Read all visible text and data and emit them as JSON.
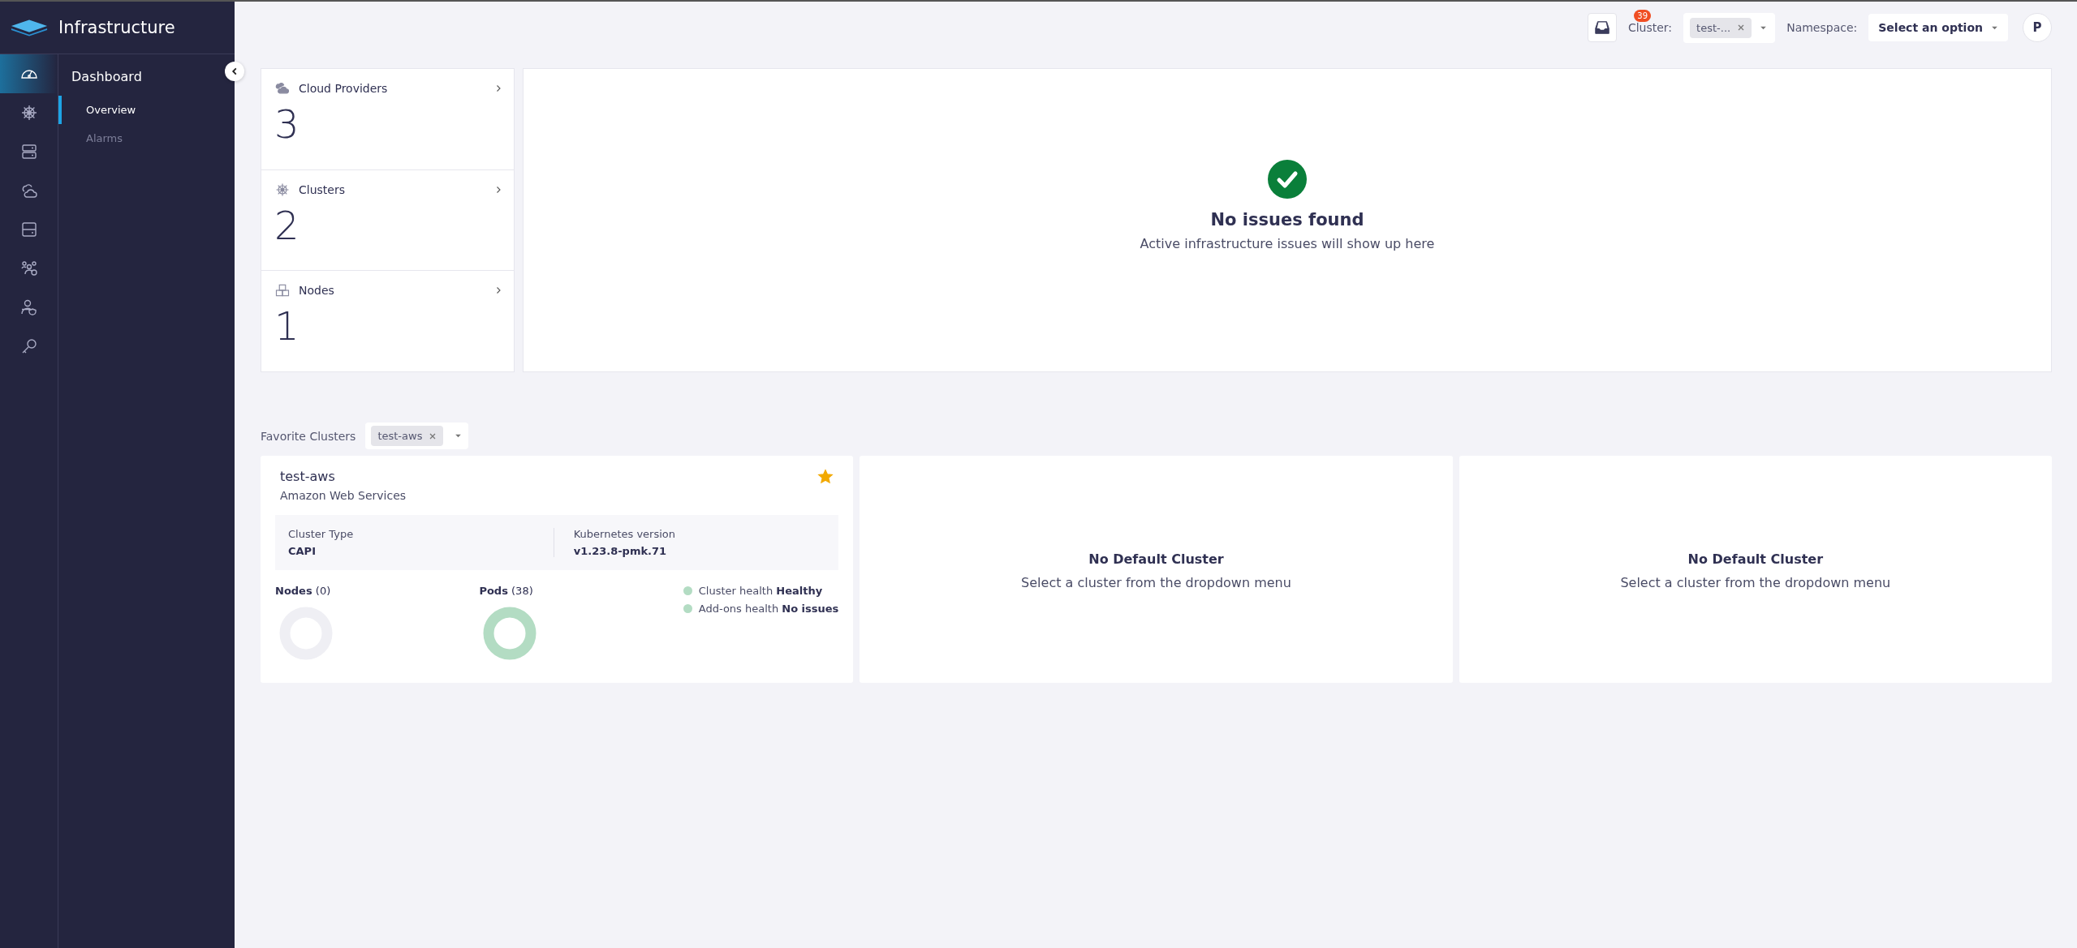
{
  "app": {
    "title": "Infrastructure"
  },
  "rail": [
    {
      "kind": "dashboard",
      "selected": true
    },
    {
      "kind": "helm",
      "selected": false
    },
    {
      "kind": "servers",
      "selected": false
    },
    {
      "kind": "clouds",
      "selected": false
    },
    {
      "kind": "storage",
      "selected": false
    },
    {
      "kind": "tenants",
      "selected": false
    },
    {
      "kind": "user-shield",
      "selected": false
    },
    {
      "kind": "key",
      "selected": false
    }
  ],
  "subnav": {
    "title": "Dashboard",
    "items": [
      {
        "label": "Overview",
        "selected": true
      },
      {
        "label": "Alarms",
        "selected": false
      }
    ]
  },
  "topbar": {
    "notifications": "39",
    "cluster_label": "Cluster:",
    "cluster_chip": "test-...",
    "namespace_label": "Namespace:",
    "namespace_value": "Select an option",
    "avatar": "P"
  },
  "summary": [
    {
      "kind": "clouds",
      "title": "Cloud Providers",
      "count": "3"
    },
    {
      "kind": "helm",
      "title": "Clusters",
      "count": "2"
    },
    {
      "kind": "nodes",
      "title": "Nodes",
      "count": "1"
    }
  ],
  "issues": {
    "title": "No issues found",
    "subtitle": "Active infrastructure issues will show up here"
  },
  "favorites": {
    "label": "Favorite Clusters",
    "chip": "test-aws"
  },
  "cluster_cards": [
    {
      "kind": "cluster",
      "name": "test-aws",
      "provider": "Amazon Web Services",
      "starred": true,
      "fields": [
        {
          "label": "Cluster Type",
          "value": "CAPI"
        },
        {
          "label": "Kubernetes version",
          "value": "v1.23.8-pmk.71"
        }
      ],
      "nodes_label": "Nodes",
      "nodes_count": "(0)",
      "pods_label": "Pods",
      "pods_count": "(38)",
      "health": [
        {
          "label": "Cluster health",
          "value": "Healthy",
          "color": "#b3dcc3"
        },
        {
          "label": "Add-ons health",
          "value": "No issues",
          "color": "#b3dcc3"
        }
      ]
    },
    {
      "kind": "empty",
      "title": "No Default Cluster",
      "subtitle": "Select a cluster from the dropdown menu"
    },
    {
      "kind": "empty",
      "title": "No Default Cluster",
      "subtitle": "Select a cluster from the dropdown menu"
    }
  ]
}
